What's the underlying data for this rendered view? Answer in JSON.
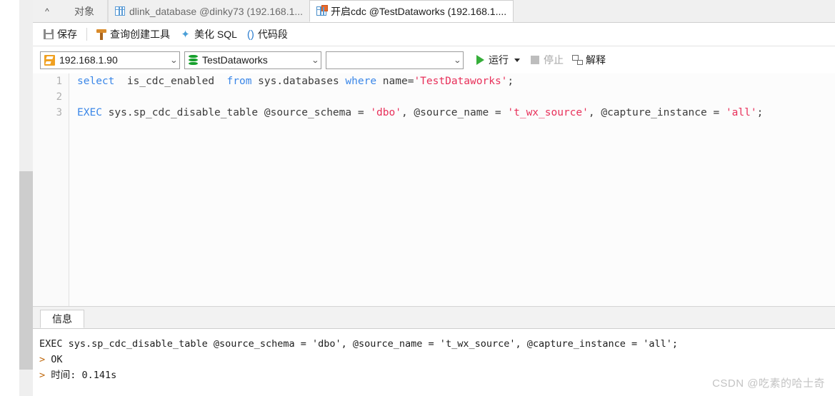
{
  "tabs": {
    "chevron_icon": "chevron-up-icon",
    "object_tab": "对象",
    "items": [
      {
        "label": "dlink_database @dinky73 (192.168.1...",
        "icon": "table-grid-icon",
        "active": false
      },
      {
        "label": "开启cdc @TestDataworks (192.168.1....",
        "icon": "table-grid-accent-icon",
        "active": true
      }
    ]
  },
  "toolbar": {
    "save_label": "保存",
    "save_icon": "save-disk-icon",
    "query_builder_label": "查询创建工具",
    "query_builder_icon": "query-tool-icon",
    "beautify_label": "美化 SQL",
    "beautify_icon": "magic-wand-icon",
    "snippet_label": "代码段",
    "snippet_icon": "parentheses-icon"
  },
  "connection_bar": {
    "server": {
      "value": "192.168.1.90",
      "icon": "server-icon"
    },
    "database": {
      "value": "TestDataworks",
      "icon": "database-icon"
    },
    "schema": {
      "value": "",
      "icon": ""
    },
    "run_label": "运行",
    "run_icon": "play-triangle-icon",
    "run_dropdown_icon": "caret-down-icon",
    "stop_label": "停止",
    "stop_icon": "stop-square-icon",
    "explain_label": "解释",
    "explain_icon": "explain-plan-icon"
  },
  "editor": {
    "line_numbers": [
      "1",
      "2",
      "3"
    ],
    "lines": [
      [
        {
          "t": "select",
          "c": "kw"
        },
        {
          "t": "  is_cdc_enabled  ",
          "c": "pl"
        },
        {
          "t": "from",
          "c": "kw"
        },
        {
          "t": " sys.databases ",
          "c": "pl"
        },
        {
          "t": "where",
          "c": "kw"
        },
        {
          "t": " name=",
          "c": "pl"
        },
        {
          "t": "'TestDataworks'",
          "c": "str"
        },
        {
          "t": ";",
          "c": "pl"
        }
      ],
      [],
      [
        {
          "t": "EXEC",
          "c": "kw"
        },
        {
          "t": " sys.sp_cdc_disable_table @source_schema = ",
          "c": "pl"
        },
        {
          "t": "'dbo'",
          "c": "str"
        },
        {
          "t": ", @source_name = ",
          "c": "pl"
        },
        {
          "t": "'t_wx_source'",
          "c": "str"
        },
        {
          "t": ", @capture_instance = ",
          "c": "pl"
        },
        {
          "t": "'all'",
          "c": "str"
        },
        {
          "t": ";",
          "c": "pl"
        }
      ]
    ]
  },
  "results": {
    "tab_label": "信息",
    "lines": [
      {
        "arrow": "",
        "text": "EXEC sys.sp_cdc_disable_table @source_schema = 'dbo', @source_name = 't_wx_source', @capture_instance = 'all';"
      },
      {
        "arrow": ">",
        "text": " OK"
      },
      {
        "arrow": ">",
        "text": " 时间: 0.141s"
      }
    ]
  },
  "watermark": "CSDN @吃素的哈士奇",
  "colors": {
    "keyword": "#3b87e8",
    "string": "#e8305a",
    "run_green": "#36ae3a",
    "server_orange": "#f0a020",
    "db_green": "#16a02c",
    "tab_accent": "#e8692a"
  }
}
